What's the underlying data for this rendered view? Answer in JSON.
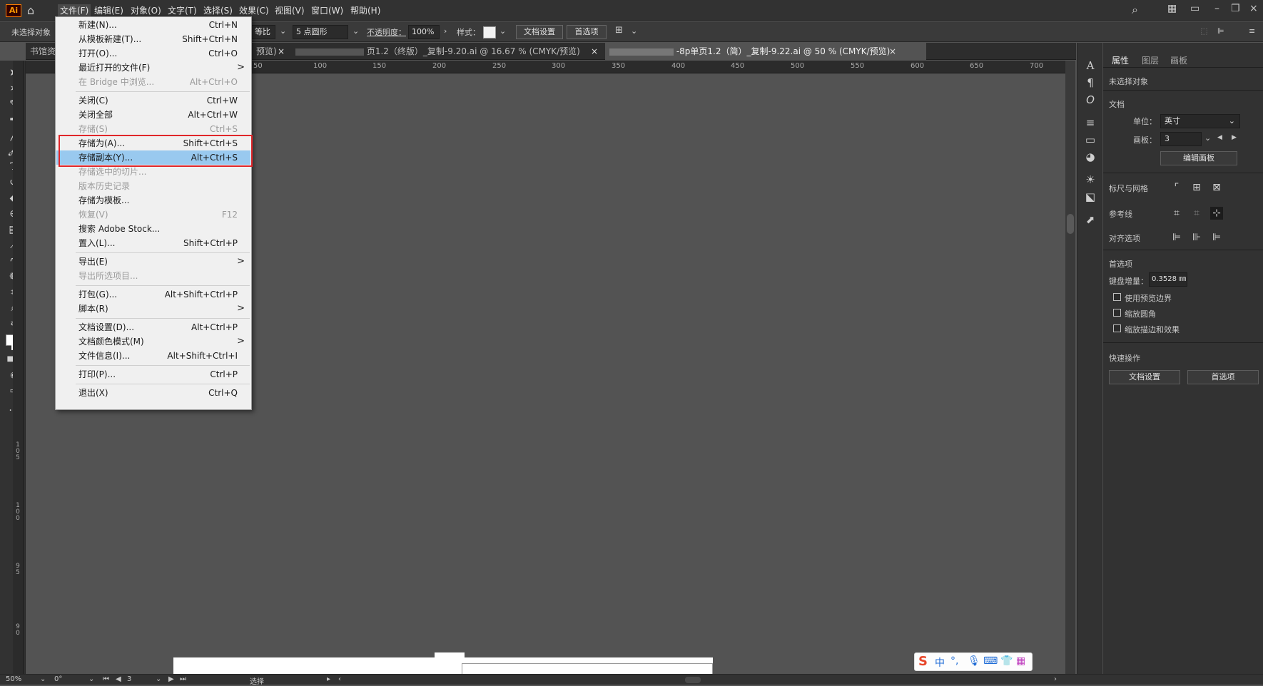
{
  "app": {
    "logo": "Ai",
    "menus": [
      "文件(F)",
      "编辑(E)",
      "对象(O)",
      "文字(T)",
      "选择(S)",
      "效果(C)",
      "视图(V)",
      "窗口(W)",
      "帮助(H)"
    ]
  },
  "control_bar": {
    "selection_status": "未选择对象",
    "ratio_label": "等比",
    "brush_label": "5 点圆形",
    "opacity_label": "不透明度：",
    "opacity_value": "100%",
    "style_label": "样式：",
    "doc_setup_button": "文档设置",
    "prefs_button": "首选项"
  },
  "tabs": [
    {
      "label": "书馆资",
      "close": "×"
    },
    {
      "label": "预览)",
      "close": "×"
    },
    {
      "label": "页1.2（终版）_复制-9.20.ai @ 16.67 % (CMYK/预览)",
      "close": "×"
    },
    {
      "label": "-8p单页1.2（简）_复制-9.22.ai @ 50 % (CMYK/预览)",
      "close": "×",
      "active": true
    }
  ],
  "ruler_h_ticks": [
    "50",
    "100",
    "150",
    "200",
    "250",
    "300",
    "350",
    "400",
    "450",
    "500",
    "550",
    "600",
    "650",
    "700"
  ],
  "ruler_v_ticks": [
    "1 0 5",
    "1 0 0",
    "9 5",
    "9 0"
  ],
  "file_menu": [
    {
      "label": "新建(N)...",
      "shortcut": "Ctrl+N"
    },
    {
      "label": "从模板新建(T)...",
      "shortcut": "Shift+Ctrl+N"
    },
    {
      "label": "打开(O)...",
      "shortcut": "Ctrl+O"
    },
    {
      "label": "最近打开的文件(F)",
      "submenu": ">"
    },
    {
      "label": "在 Bridge 中浏览...",
      "shortcut": "Alt+Ctrl+O",
      "disabled": true
    },
    {
      "label": "关闭(C)",
      "shortcut": "Ctrl+W"
    },
    {
      "label": "关闭全部",
      "shortcut": "Alt+Ctrl+W"
    },
    {
      "label": "存储(S)",
      "shortcut": "Ctrl+S",
      "disabled": true
    },
    {
      "label": "存储为(A)...",
      "shortcut": "Shift+Ctrl+S"
    },
    {
      "label": "存储副本(Y)...",
      "shortcut": "Alt+Ctrl+S",
      "highlighted": true
    },
    {
      "label": "存储选中的切片...",
      "disabled": true
    },
    {
      "label": "版本历史记录",
      "disabled": true
    },
    {
      "label": "存储为模板..."
    },
    {
      "label": "恢复(V)",
      "shortcut": "F12",
      "disabled": true
    },
    {
      "label": "搜索 Adobe Stock..."
    },
    {
      "label": "置入(L)...",
      "shortcut": "Shift+Ctrl+P"
    },
    {
      "label": "导出(E)",
      "submenu": ">"
    },
    {
      "label": "导出所选项目...",
      "disabled": true
    },
    {
      "label": "打包(G)...",
      "shortcut": "Alt+Shift+Ctrl+P"
    },
    {
      "label": "脚本(R)",
      "submenu": ">"
    },
    {
      "label": "文档设置(D)...",
      "shortcut": "Alt+Ctrl+P"
    },
    {
      "label": "文档颜色模式(M)",
      "submenu": ">"
    },
    {
      "label": "文件信息(I)...",
      "shortcut": "Alt+Shift+Ctrl+I"
    },
    {
      "label": "打印(P)...",
      "shortcut": "Ctrl+P"
    },
    {
      "label": "退出(X)",
      "shortcut": "Ctrl+Q"
    }
  ],
  "panel": {
    "tabs": [
      "属性",
      "图层",
      "画板"
    ],
    "no_selection": "未选择对象",
    "document_section": "文档",
    "units_label": "单位：",
    "units_value": "英寸",
    "artboard_label": "画板：",
    "artboard_value": "3",
    "edit_artboards_button": "编辑画板",
    "rulers_grids": "标尺与网格",
    "guides": "参考线",
    "align_options": "对齐选项",
    "preferences_section": "首选项",
    "keyboard_increment_label": "键盘增量：",
    "keyboard_increment_value": "0.3528 ㎜",
    "checkbox_preview_bounds": "使用预览边界",
    "checkbox_scale_corners": "缩放圆角",
    "checkbox_scale_strokes": "缩放描边和效果",
    "quick_actions": "快速操作",
    "doc_setup_button": "文档设置",
    "prefs_button": "首选项"
  },
  "status_bar": {
    "zoom": "50%",
    "rotation": "0°",
    "artboard_number": "3",
    "mode": "选择"
  },
  "ime": {
    "brand": "S",
    "mode": "中"
  }
}
